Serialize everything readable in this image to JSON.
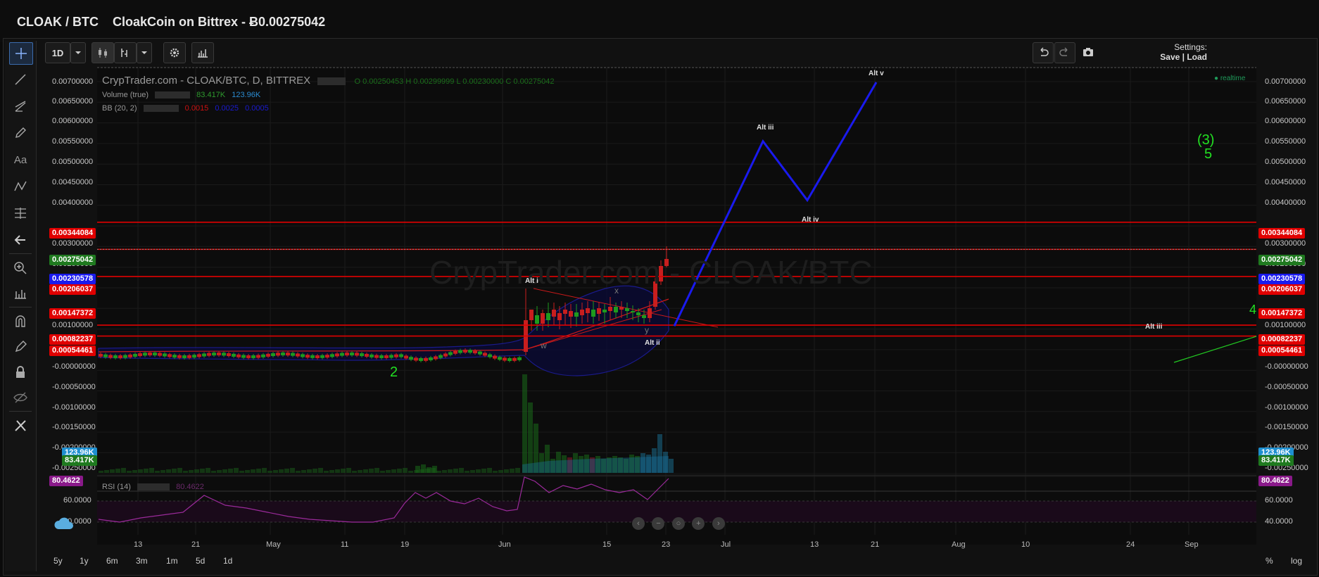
{
  "window": {
    "pair": "CLOAK / BTC",
    "title": "CloakCoin on Bittrex - Ƀ0.00275042"
  },
  "toolbar": {
    "interval": "1D",
    "settings_label": "Settings:",
    "save_load": "Save | Load"
  },
  "legend": {
    "main": "CrypTrader.com - CLOAK/BTC, D, BITTREX",
    "ohlc": "O 0.00250453  H 0.00299999  L 0.00230000  C 0.00275042",
    "volume_label": "Volume (true)",
    "volume_a": "83.417K",
    "volume_b": "123.96K",
    "bb_label": "BB (20, 2)",
    "bb_a": "0.0015",
    "bb_b": "0.0025",
    "bb_c": "0.0005",
    "realtime": "realtime",
    "watermark": "CrypTrader.com - CLOAK/BTC",
    "rsi_label": "RSI (14)",
    "rsi_value": "80.4622"
  },
  "yaxis_ticks": [
    "0.00700000",
    "0.00650000",
    "0.00600000",
    "0.00550000",
    "0.00500000",
    "0.00450000",
    "0.00400000",
    "0.00300000",
    "0.00250000",
    "0.00100000",
    "-0.00000000",
    "-0.00050000",
    "-0.00100000",
    "-0.00150000",
    "-0.00200000",
    "-0.00250000"
  ],
  "price_tags": [
    {
      "value": "0.00344084",
      "color": "#e00000"
    },
    {
      "value": "0.00275042",
      "color": "#1f7a1f"
    },
    {
      "value": "0.00230578",
      "color": "#1a1aee"
    },
    {
      "value": "0.00206037",
      "color": "#e00000"
    },
    {
      "value": "0.00147372",
      "color": "#e00000"
    },
    {
      "value": "0.00082237",
      "color": "#e00000"
    },
    {
      "value": "0.00054461",
      "color": "#e00000"
    }
  ],
  "volume_tags": [
    {
      "value": "123.96K",
      "color": "#1e8fd0"
    },
    {
      "value": "83.417K",
      "color": "#1f7a1f"
    }
  ],
  "rsi_ticks": [
    "60.0000",
    "40.0000"
  ],
  "x_labels": [
    "13",
    "21",
    "May",
    "11",
    "19",
    "Jun",
    "15",
    "23",
    "Jul",
    "13",
    "21",
    "Aug",
    "10",
    "24",
    "Sep"
  ],
  "wave_labels": {
    "alt_i": "Alt i",
    "alt_ii": "Alt ii",
    "alt_iii": "Alt iii",
    "alt_iv": "Alt iv",
    "alt_v": "Alt v",
    "alt_iii_right": "Alt iii",
    "w": "w",
    "x": "x",
    "y": "y",
    "two": "2",
    "three": "(3)",
    "five": "5",
    "four": "4"
  },
  "ranges": [
    "5y",
    "1y",
    "6m",
    "3m",
    "1m",
    "5d",
    "1d"
  ],
  "scale_buttons": [
    "%",
    "log"
  ],
  "chart_data": {
    "type": "line",
    "title": "CrypTrader.com - CLOAK/BTC, D, BITTREX",
    "xlabel": "",
    "ylabel": "",
    "ylim": [
      -0.0025,
      0.0072
    ],
    "horizontal_levels": [
      0.00344084,
      0.00275042,
      0.00206037,
      0.00082237,
      0.00054461
    ],
    "projection": {
      "x": [
        "Jun 24",
        "Jul 6",
        "Jul 12",
        "Jul 21"
      ],
      "values": [
        0.0008,
        0.0055,
        0.004,
        0.007
      ]
    },
    "last_close": 0.00275042,
    "rsi_last": 80.4622
  }
}
